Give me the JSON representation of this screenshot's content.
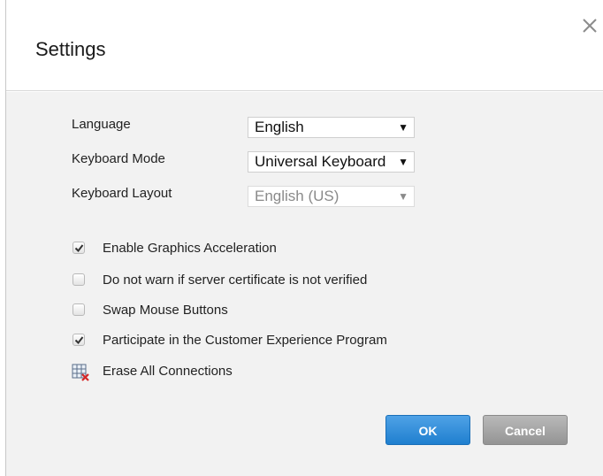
{
  "dialog": {
    "title": "Settings",
    "close_icon": "close-icon"
  },
  "form": {
    "language": {
      "label": "Language",
      "value": "English"
    },
    "keyboard_mode": {
      "label": "Keyboard Mode",
      "value": "Universal Keyboard"
    },
    "keyboard_layout": {
      "label": "Keyboard Layout",
      "value": "English (US)",
      "disabled": true
    }
  },
  "options": [
    {
      "label": "Enable Graphics Acceleration",
      "checked": true
    },
    {
      "label": "Do not warn if server certificate is not verified",
      "checked": false
    },
    {
      "label": "Swap Mouse Buttons",
      "checked": false
    },
    {
      "label": "Participate in the Customer Experience Program",
      "checked": true
    }
  ],
  "erase": {
    "label": "Erase All Connections",
    "icon": "erase-table-icon"
  },
  "buttons": {
    "ok": "OK",
    "cancel": "Cancel"
  },
  "colors": {
    "ok": "#1f7fcf",
    "cancel": "#949494",
    "body_bg": "#f2f2f2"
  }
}
